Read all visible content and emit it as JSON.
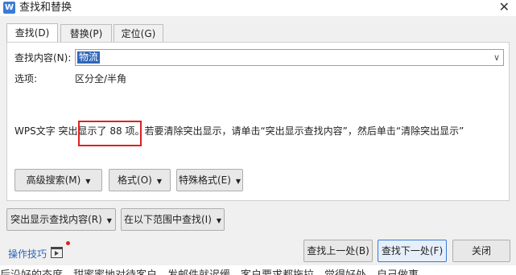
{
  "window": {
    "title": "查找和替换",
    "app_icon_letter": "W"
  },
  "tabs": [
    {
      "label": "查找(D)",
      "active": true
    },
    {
      "label": "替换(P)",
      "active": false
    },
    {
      "label": "定位(G)",
      "active": false
    }
  ],
  "find": {
    "label": "查找内容(N):",
    "value": "物流"
  },
  "options": {
    "label": "选项:",
    "value": "区分全/半角"
  },
  "status": {
    "prefix": "WPS文字 突出",
    "highlighted": "显示了 88 项。",
    "suffix": "若要清除突出显示，请单击“突出显示查找内容”，然后单击“清除突出显示”",
    "highlight_color": "#e02020"
  },
  "buttons": {
    "advanced_search": "高级搜索(M)",
    "format": "格式(O)",
    "special_format": "特殊格式(E)",
    "highlight_find": "突出显示查找内容(R)",
    "find_in": "在以下范围中查找(I)",
    "find_prev": "查找上一处(B)",
    "find_next": "查找下一处(F)",
    "close": "关闭"
  },
  "tips": {
    "label": "操作技巧"
  },
  "background_text": "后沿好的态度，甜蜜蜜地对待客户，发邮件就迟缓，客户要求都拖拉，觉得好处，自己做事"
}
